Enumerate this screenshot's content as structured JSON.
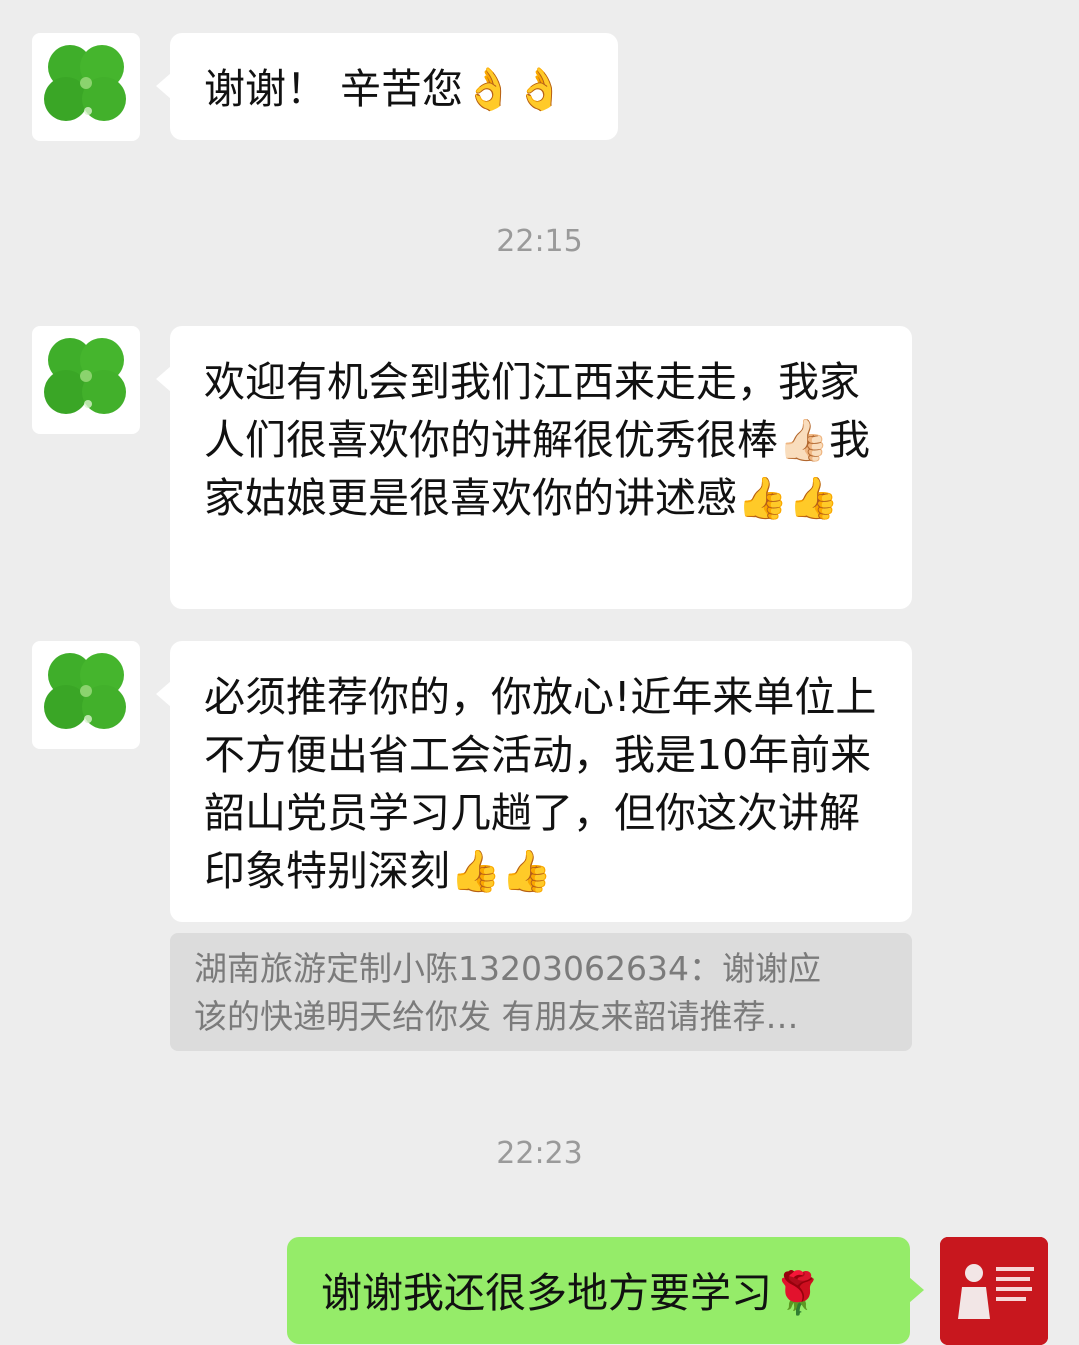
{
  "colors": {
    "background": "#ededed",
    "incoming_bubble": "#ffffff",
    "outgoing_bubble": "#95ec69",
    "timestamp_text": "#9a9a9a",
    "quote_bg": "#dcdcdc",
    "self_avatar_bg": "#c8171e",
    "contact_avatar_leaf": "#3fae2a"
  },
  "contact_avatar_icon": "four-leaf-clover-icon",
  "self_avatar_icon": "red-poster-avatar-icon",
  "messages": [
    {
      "sender": "contact",
      "text": "谢谢！ 辛苦您👌👌"
    },
    {
      "sender": "contact",
      "text": "欢迎有机会到我们江西来走走，我家人们很喜欢你的讲解很优秀很棒👍🏻我家姑娘更是很喜欢你的讲述感👍👍"
    },
    {
      "sender": "contact",
      "text": "必须推荐你的，你放心!近年来单位上不方便出省工会活动，我是10年前来韶山党员学习几趟了，但你这次讲解印象特别深刻👍👍"
    },
    {
      "sender": "self",
      "text": "谢谢我还很多地方要学习🌹"
    }
  ],
  "timestamps": [
    "22:15",
    "22:23"
  ],
  "quote": {
    "line1": "湖南旅游定制小陈13203062634：谢谢应",
    "line2": "该的快递明天给你发 有朋友来韶请推荐…"
  }
}
